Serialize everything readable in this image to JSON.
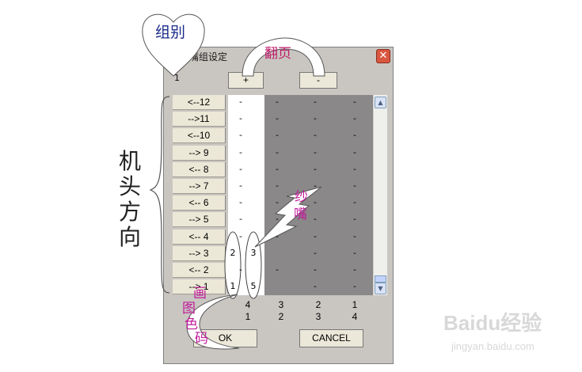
{
  "window": {
    "title": "纱嘴组设定",
    "close_glyph": "✕"
  },
  "group_number": "1",
  "page_buttons": {
    "plus": "+",
    "minus": "-"
  },
  "rows": [
    {
      "label": "<--12",
      "cells": [
        "-",
        "-",
        "-",
        "-"
      ]
    },
    {
      "label": "-->11",
      "cells": [
        "-",
        "-",
        "-",
        "-"
      ]
    },
    {
      "label": "<--10",
      "cells": [
        "-",
        "-",
        "-",
        "-"
      ]
    },
    {
      "label": "--> 9",
      "cells": [
        "-",
        "-",
        "-",
        "-"
      ]
    },
    {
      "label": "<-- 8",
      "cells": [
        "-",
        "-",
        "-",
        "-"
      ]
    },
    {
      "label": "--> 7",
      "cells": [
        "-",
        "-",
        "-",
        "-"
      ]
    },
    {
      "label": "<-- 6",
      "cells": [
        "-",
        "-",
        "-",
        "-"
      ]
    },
    {
      "label": "--> 5",
      "cells": [
        "-",
        "-",
        "-",
        "-"
      ]
    },
    {
      "label": "<-- 4",
      "cells": [
        "-",
        "-",
        "-",
        "-"
      ]
    },
    {
      "label": "--> 3",
      "cells": [
        "2",
        "3",
        "-",
        "-"
      ]
    },
    {
      "label": "<-- 2",
      "cells": [
        "-",
        "-",
        "-",
        "-"
      ]
    },
    {
      "label": "--> 1",
      "cells": [
        "1",
        "5",
        "-",
        "-"
      ]
    }
  ],
  "color_codes": {
    "row1": [
      "4",
      "3",
      "2",
      "1"
    ],
    "row2": [
      "1",
      "2",
      "3",
      "4"
    ]
  },
  "buttons": {
    "ok": "OK",
    "cancel": "CANCEL"
  },
  "scrollbar": {
    "up_glyph": "▲",
    "down_glyph": "▼"
  },
  "annotations": {
    "group": "组别",
    "flip_page": "翻页",
    "head_direction": [
      "机",
      "头",
      "方",
      "向"
    ],
    "yarn_nozzle": [
      "纱",
      "嘴"
    ],
    "paint_color_code": [
      "画",
      "图",
      "色",
      "码"
    ]
  },
  "watermark": {
    "main": "Baidu经验",
    "sub": "jingyan.baidu.com"
  },
  "colors": {
    "annotation_magenta": "#c01b9a",
    "annotation_blue": "#1a2a8a",
    "close_red": "#d9573f"
  }
}
